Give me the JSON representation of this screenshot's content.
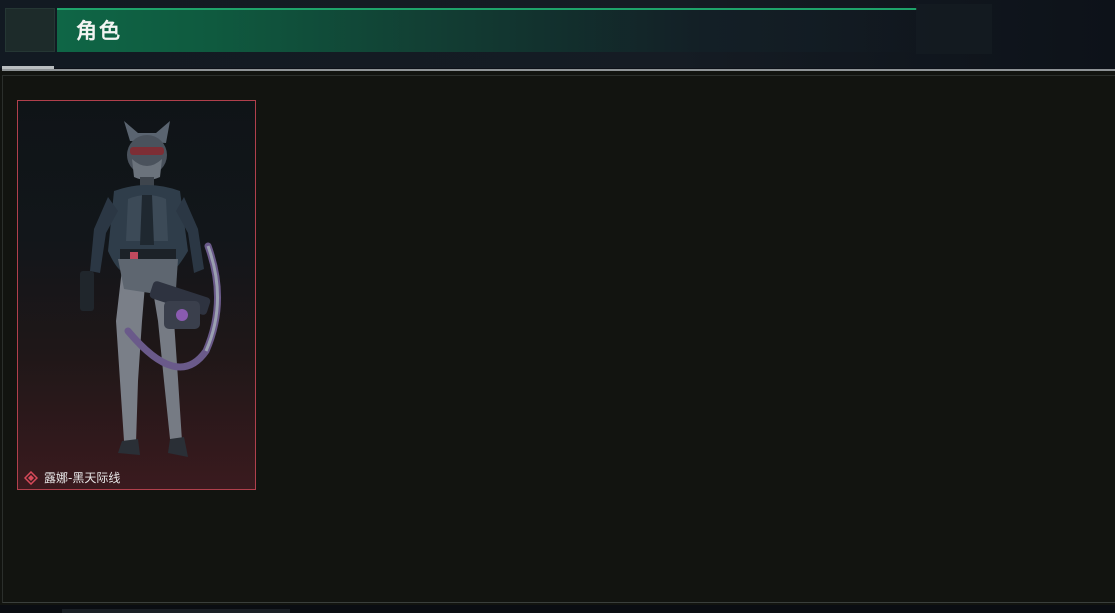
{
  "header": {
    "title": "角色"
  },
  "characters": [
    {
      "name": "露娜-黑天际线",
      "rarity_icon": "red-diamond-icon",
      "border_color": "#b0404c"
    }
  ],
  "colors": {
    "accent_green": "#0f6646",
    "accent_green_edge": "#1ea36a",
    "card_border": "#b0404c",
    "panel_bg": "#121410"
  }
}
